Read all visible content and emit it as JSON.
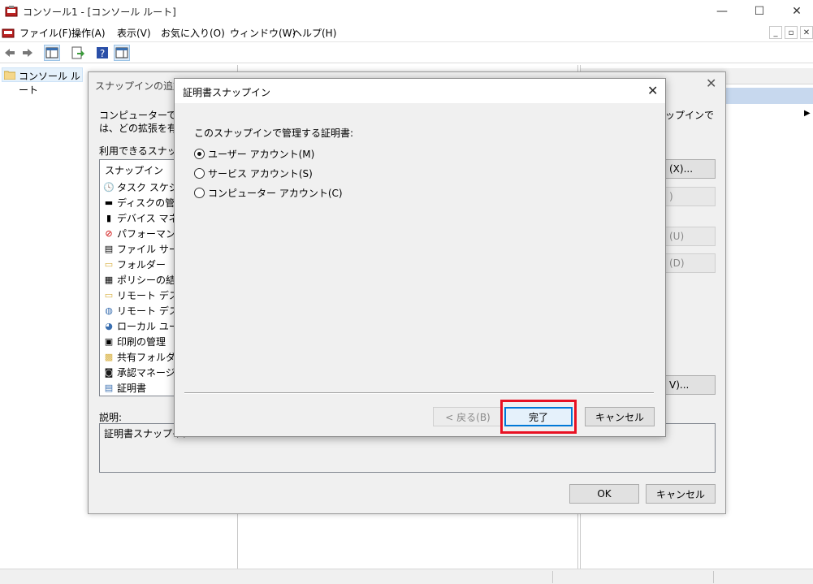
{
  "window": {
    "title": "コンソール1 - [コンソール ルート]"
  },
  "menu": [
    "ファイル(F)",
    "操作(A)",
    "表示(V)",
    "お気に入り(O)",
    "ウィンドウ(W)",
    "ヘルプ(H)"
  ],
  "tree": {
    "root": "コンソール ルート"
  },
  "add_dialog": {
    "title": "スナップインの追加と",
    "desc_line1": "コンピューターで利用",
    "desc_line2": "は、どの拡張を有効",
    "available_label": "利用できるスナップイ",
    "list_header": "スナップイン",
    "snapins": [
      {
        "label": "タスク スケジュー",
        "icon": "clock-icon"
      },
      {
        "label": "ディスクの管理",
        "icon": "disk-icon"
      },
      {
        "label": "デバイス マネージ",
        "icon": "device-icon"
      },
      {
        "label": "パフォーマンス モ",
        "icon": "performance-icon"
      },
      {
        "label": "ファイル サーバー",
        "icon": "file-server-icon"
      },
      {
        "label": "フォルダー",
        "icon": "folder-icon"
      },
      {
        "label": "ポリシーの結果",
        "icon": "policy-icon"
      },
      {
        "label": "リモート デスクト",
        "icon": "folder-icon"
      },
      {
        "label": "リモート デスクト",
        "icon": "remote-desktop-icon"
      },
      {
        "label": "ローカル ユーザー",
        "icon": "users-icon"
      },
      {
        "label": "印刷の管理",
        "icon": "printer-icon"
      },
      {
        "label": "共有フォルダー",
        "icon": "shared-folder-icon"
      },
      {
        "label": "承認マネージャ",
        "icon": "authorization-icon"
      },
      {
        "label": "証明書",
        "icon": "certificate-icon"
      }
    ],
    "description_label": "説明:",
    "description_text": "証明書スナップイン",
    "right_text": "ップインで",
    "side_buttons": [
      {
        "label": "(X)...",
        "disabled": false
      },
      {
        "label": ")",
        "disabled": true
      },
      {
        "label": "(U)",
        "disabled": true
      },
      {
        "label": "(D)",
        "disabled": true
      },
      {
        "label": "V)...",
        "disabled": false
      }
    ],
    "ok": "OK",
    "cancel": "キャンセル"
  },
  "cert_dialog": {
    "title": "証明書スナップイン",
    "prompt": "このスナップインで管理する証明書:",
    "options": [
      {
        "label": "ユーザー アカウント(M)",
        "selected": true
      },
      {
        "label": "サービス アカウント(S)",
        "selected": false
      },
      {
        "label": "コンピューター アカウント(C)",
        "selected": false
      }
    ],
    "back": "< 戻る(B)",
    "finish": "完了",
    "cancel": "キャンセル"
  },
  "colors": {
    "highlight": "#e81123",
    "selection": "#c7d8ee",
    "focus_border": "#0078d7"
  }
}
